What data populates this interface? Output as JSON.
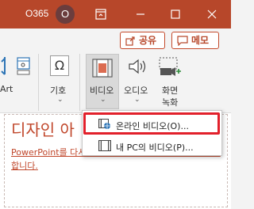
{
  "titlebar": {
    "user_name": "O365",
    "avatar_initial": "O"
  },
  "ribbon": {
    "share_label": "공유",
    "comments_label": "메모",
    "partial_label": "Art",
    "symbols_label": "기호",
    "video_label": "비디오",
    "audio_label": "오디오",
    "screen_recording_line1": "화면",
    "screen_recording_line2": "녹화"
  },
  "menu": {
    "online_video": "온라인 비디오(O)...",
    "pc_video": "내 PC의 비디오(P)..."
  },
  "slide": {
    "design_title": "디자인 아",
    "design_text": "PowerPoint를 다시 시작할 때까지 아이디어 제안을 중지합니다."
  },
  "colors": {
    "accent": "#b7472a",
    "highlight": "#e2202b"
  }
}
